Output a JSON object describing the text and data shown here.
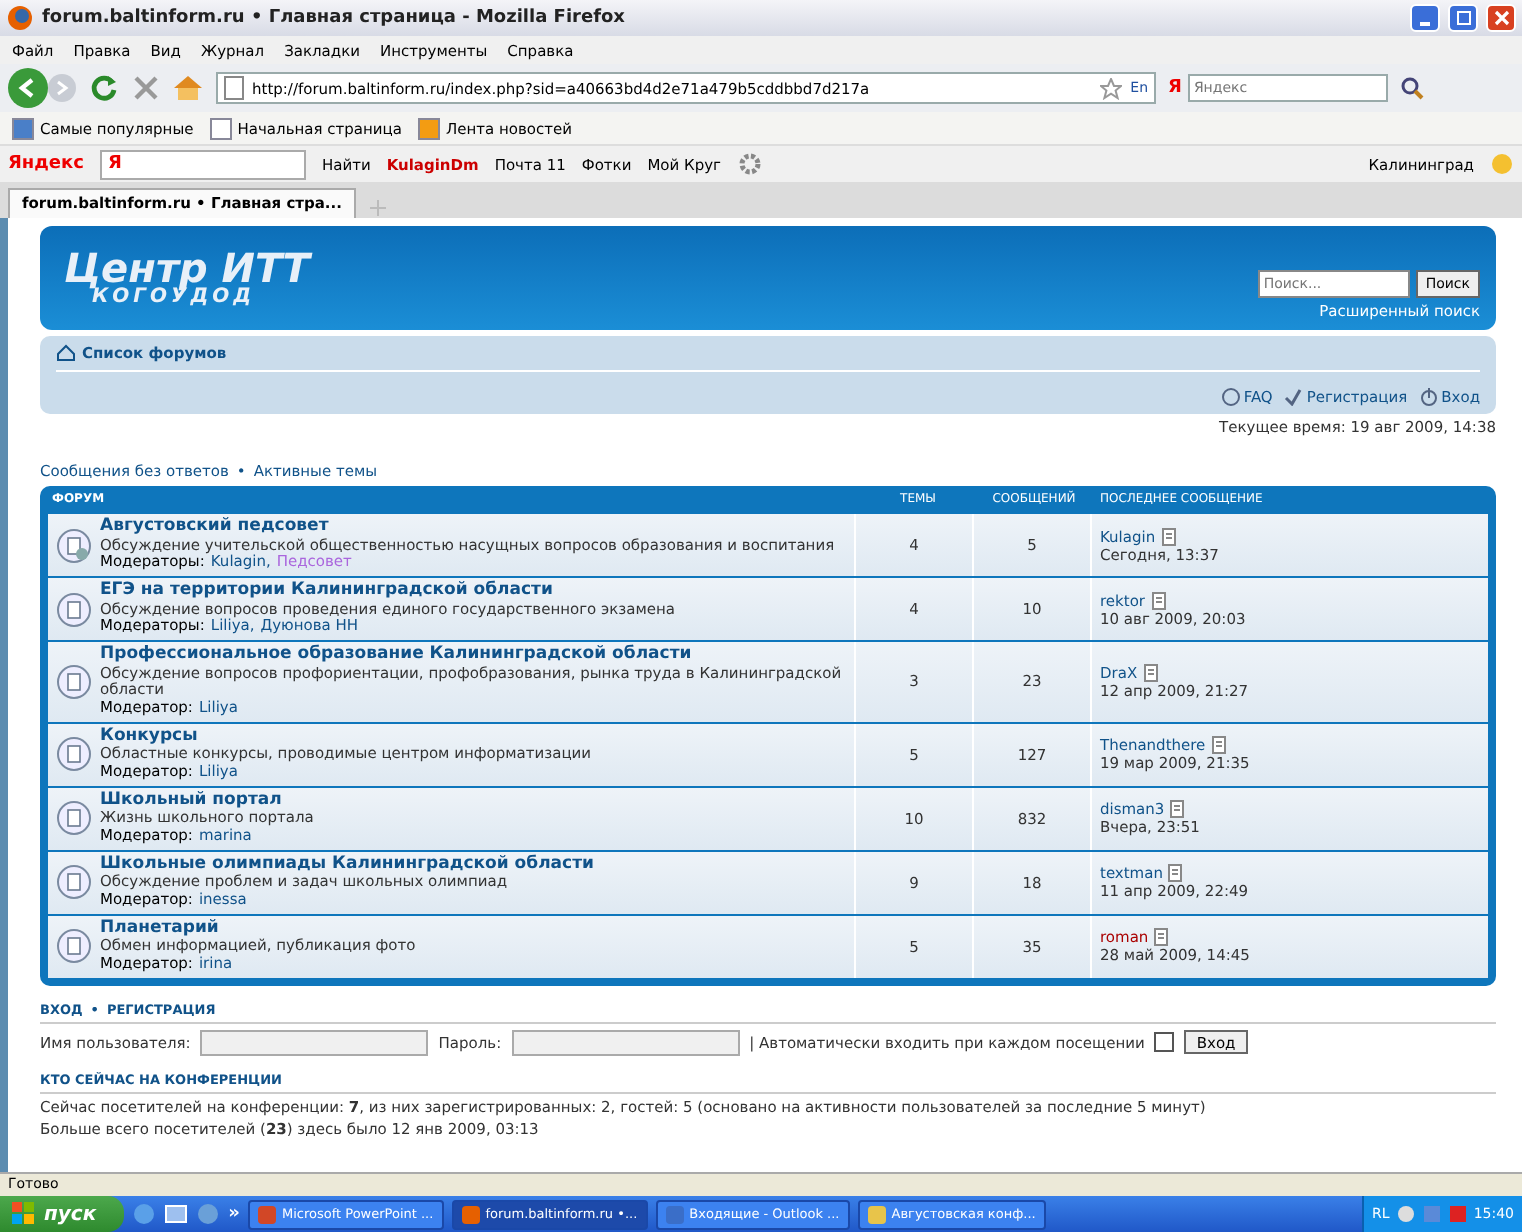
{
  "window": {
    "title": "forum.baltinform.ru • Главная страница - Mozilla Firefox"
  },
  "menu": [
    {
      "label": "Файл"
    },
    {
      "label": "Правка"
    },
    {
      "label": "Вид"
    },
    {
      "label": "Журнал"
    },
    {
      "label": "Закладки"
    },
    {
      "label": "Инструменты"
    },
    {
      "label": "Справка"
    }
  ],
  "address": {
    "value": "http://forum.baltinform.ru/index.php?sid=a40663bd4d2e71a479b5cddbbd7d217a",
    "lang": "En",
    "search_logo": "Я",
    "search_placeholder": "Яндекс"
  },
  "bookmarks": [
    {
      "label": "Самые популярные",
      "kind": "folder"
    },
    {
      "label": "Начальная страница",
      "kind": "page"
    },
    {
      "label": "Лента новостей",
      "kind": "feed"
    }
  ],
  "yandex_bar": {
    "brand": "Яндекс",
    "logo": "Я",
    "find": "Найти",
    "user": "KulaginDm",
    "mail": "Почта 11",
    "photos": "Фотки",
    "circle": "Мой Круг",
    "city": "Калининград"
  },
  "tabs": [
    {
      "label": "forum.baltinform.ru • Главная стра...",
      "selected": true
    }
  ],
  "site": {
    "logo_line1": "Центр ИТТ",
    "logo_line2": "КОГОУДОД",
    "search_placeholder": "Поиск...",
    "search_button": "Поиск",
    "advanced_search": "Расширенный поиск"
  },
  "navbar": {
    "breadcrumb": "Список форумов",
    "links": [
      {
        "label": "FAQ",
        "kind": "faq"
      },
      {
        "label": "Регистрация",
        "kind": "register"
      },
      {
        "label": "Вход",
        "kind": "login"
      }
    ],
    "time": "Текущее время: 19 авг 2009, 14:38"
  },
  "quick_links": [
    {
      "label": "Сообщения без ответов"
    },
    {
      "label": "Активные темы",
      "separator": "•"
    }
  ],
  "table": {
    "columns": [
      "ФОРУМ",
      "ТЕМЫ",
      "СООБЩЕНИЙ",
      "ПОСЛЕДНЕЕ СООБЩЕНИЕ"
    ],
    "rows": [
      {
        "title": "Августовский педсовет",
        "description": "Обсуждение учительской общественностью насущных вопросов образования и воспитания",
        "moderators_label": "Модераторы:",
        "moderators": [
          {
            "name": "Kulagin,",
            "color": "#105289"
          },
          {
            "name": "Педсовет",
            "color": "#aa66dd"
          }
        ],
        "topics": "4",
        "posts": "5",
        "last_user": {
          "name": "Kulagin",
          "color": "#105289"
        },
        "last_time": "Сегодня, 13:37",
        "unread": true
      },
      {
        "title": "ЕГЭ на территории Калининградской области",
        "description": "Обсуждение вопросов проведения единого государственного экзамена",
        "moderators_label": "Модераторы:",
        "moderators": [
          {
            "name": "Liliya,",
            "color": "#105289"
          },
          {
            "name": "Дуюнова НН",
            "color": "#105289"
          }
        ],
        "topics": "4",
        "posts": "10",
        "last_user": {
          "name": "rektor",
          "color": "#105289"
        },
        "last_time": "10 авг 2009, 20:03",
        "unread": false
      },
      {
        "title": "Профессиональное образование Калининградской области",
        "description": "Обсуждение вопросов профориентации, профобразования, рынка труда в Калининградской области",
        "moderators_label": "Модератор:",
        "moderators": [
          {
            "name": "Liliya",
            "color": "#105289"
          }
        ],
        "topics": "3",
        "posts": "23",
        "last_user": {
          "name": "DraX",
          "color": "#105289"
        },
        "last_time": "12 апр 2009, 21:27",
        "unread": false
      },
      {
        "title": "Конкурсы",
        "description": "Областные конкурсы, проводимые центром информатизации",
        "moderators_label": "Модератор:",
        "moderators": [
          {
            "name": "Liliya",
            "color": "#105289"
          }
        ],
        "topics": "5",
        "posts": "127",
        "last_user": {
          "name": "Thenandthere",
          "color": "#105289"
        },
        "last_time": "19 мар 2009, 21:35",
        "unread": false
      },
      {
        "title": "Школьный портал",
        "description": "Жизнь школьного портала",
        "moderators_label": "Модератор:",
        "moderators": [
          {
            "name": "marina",
            "color": "#105289"
          }
        ],
        "topics": "10",
        "posts": "832",
        "last_user": {
          "name": "disman3",
          "color": "#105289"
        },
        "last_time": "Вчера, 23:51",
        "unread": false
      },
      {
        "title": "Школьные олимпиады Калининградской области",
        "description": "Обсуждение проблем и задач школьных олимпиад",
        "moderators_label": "Модератор:",
        "moderators": [
          {
            "name": "inessa",
            "color": "#105289"
          }
        ],
        "topics": "9",
        "posts": "18",
        "last_user": {
          "name": "textman",
          "color": "#105289"
        },
        "last_time": "11 апр 2009, 22:49",
        "unread": false
      },
      {
        "title": "Планетарий",
        "description": "Обмен информацией, публикация фото",
        "moderators_label": "Модератор:",
        "moderators": [
          {
            "name": "irina",
            "color": "#105289"
          }
        ],
        "topics": "5",
        "posts": "35",
        "last_user": {
          "name": "roman",
          "color": "#aa0000"
        },
        "last_time": "28 май 2009, 14:45",
        "unread": false
      }
    ]
  },
  "login": {
    "heading_login": "ВХОД",
    "heading_separator": "•",
    "heading_register": "РЕГИСТРАЦИЯ",
    "username_label": "Имя пользователя:",
    "password_label": "Пароль:",
    "autologin_label": "| Автоматически входить при каждом посещении",
    "autologin_checked": false,
    "button": "Вход"
  },
  "online": {
    "heading": "КТО СЕЙЧАС НА КОНФЕРЕНЦИИ",
    "line1": "Сейчас посетителей на конференции: **7**, из них зарегистрированных: 2, гостей: 5 (основано на активности пользователей за последние 5 минут)",
    "line2": "Больше всего посетителей (**23**) здесь было 12 янв 2009, 03:13"
  },
  "status_bar": "Готово",
  "taskbar": {
    "start": "пуск",
    "overflow": "»",
    "tasks": [
      {
        "label": "Microsoft PowerPoint ...",
        "kind": "ppt",
        "selected": false
      },
      {
        "label": "forum.baltinform.ru •...",
        "kind": "firefox",
        "selected": true
      },
      {
        "label": "Входящие - Outlook ...",
        "kind": "outlook",
        "selected": false
      },
      {
        "label": "Августовская конф...",
        "kind": "folder",
        "selected": false
      }
    ],
    "lang": "RL",
    "clock": "15:40"
  }
}
